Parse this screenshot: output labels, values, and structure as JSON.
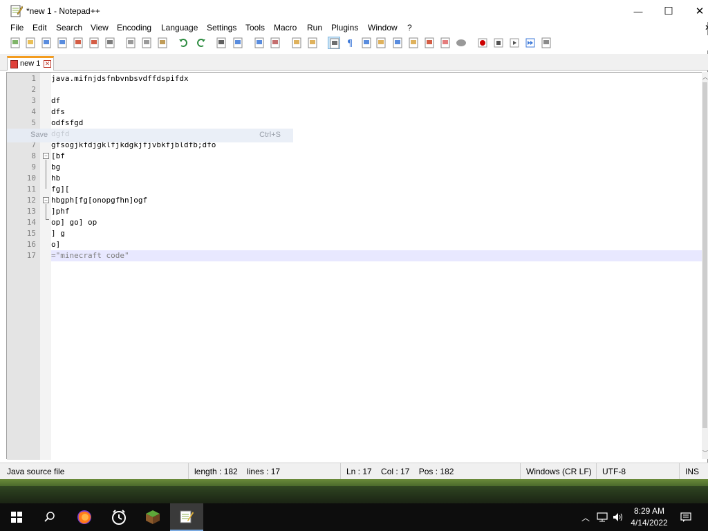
{
  "window": {
    "title": "*new 1 - Notepad++",
    "controls": {
      "minimize": "—",
      "maximize": "☐",
      "close": "✕"
    }
  },
  "menu": [
    "File",
    "Edit",
    "Search",
    "View",
    "Encoding",
    "Language",
    "Settings",
    "Tools",
    "Macro",
    "Run",
    "Plugins",
    "Window",
    "?"
  ],
  "menu_extra_close": "✕",
  "toolbar": [
    "new-file",
    "open-file",
    "save",
    "save-all",
    "close",
    "close-all",
    "print",
    "cut",
    "copy",
    "paste",
    "undo",
    "redo",
    "find",
    "replace",
    "zoom-in",
    "zoom-out",
    "sync-vertical",
    "sync-horizontal",
    "word-wrap",
    "show-all-chars",
    "indent-guide",
    "doc-map",
    "function-list",
    "user-lang",
    "folder-workspace",
    "doc-list",
    "monitoring",
    "record-macro",
    "stop-macro",
    "play-macro",
    "run-macro-multiple",
    "save-macro"
  ],
  "tab": {
    "label": "new 1"
  },
  "editor": {
    "lines": [
      "java.mifnjdsfnbvnbsvdffdspifdx",
      "",
      "df",
      "dfs",
      "odfsfgd",
      "dgfd",
      "gfsogjkfdjgklfjkdgkjfjvbkfjbldfb;dfo",
      "[bf",
      "bg",
      "hb",
      "fg][",
      "hbgph[fg[onopgfhn]ogf",
      "]phf",
      "op] go] op",
      "] g",
      "o]",
      "=\"minecraft code\""
    ],
    "line_numbers": [
      "1",
      "2",
      "3",
      "4",
      "5",
      "6",
      "7",
      "8",
      "9",
      "10",
      "11",
      "12",
      "13",
      "14",
      "15",
      "16",
      "17"
    ],
    "current_line": 17
  },
  "tooltip": {
    "label": "Save",
    "shortcut": "Ctrl+S"
  },
  "status": {
    "file_type": "Java source file",
    "length": "length : 182",
    "lines": "lines : 17",
    "ln": "Ln : 17",
    "col": "Col : 17",
    "pos": "Pos : 182",
    "eol": "Windows (CR LF)",
    "encoding": "UTF-8",
    "mode": "INS"
  },
  "taskbar": {
    "apps": [
      "start-icon",
      "search-icon",
      "firefox-icon",
      "clock-app-icon",
      "minecraft-icon",
      "notepadpp-icon"
    ],
    "time": "8:29 AM",
    "date": "4/14/2022"
  },
  "colors": {
    "tab_accent": "#f39c1f",
    "current_line": "#e8e8ff",
    "gutter": "#e4e4e4"
  }
}
